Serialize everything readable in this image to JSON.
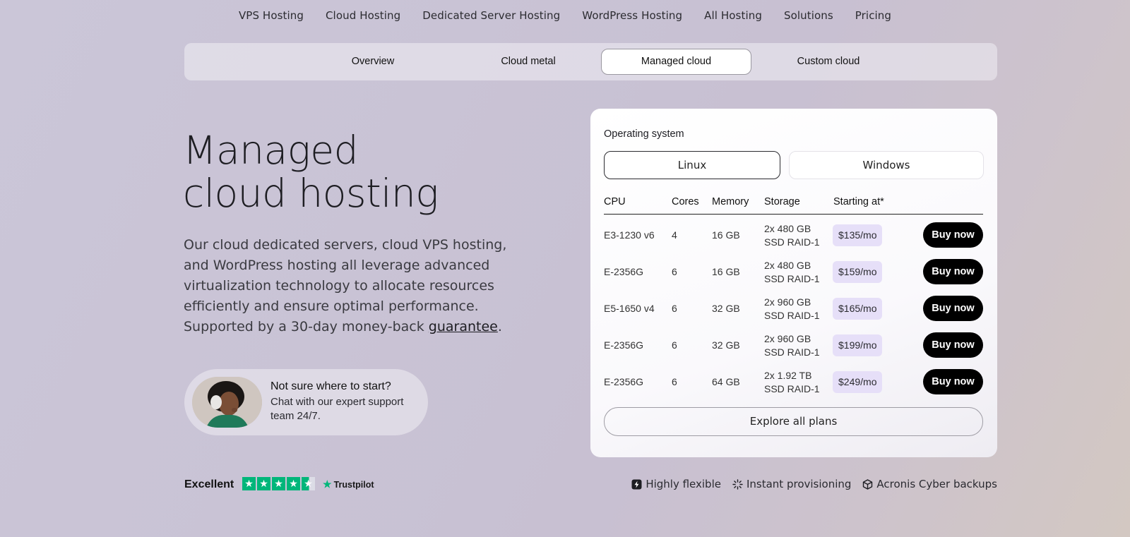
{
  "nav": [
    "VPS Hosting",
    "Cloud Hosting",
    "Dedicated Server Hosting",
    "WordPress Hosting",
    "All Hosting",
    "Solutions",
    "Pricing"
  ],
  "tabs": [
    "Overview",
    "Cloud metal",
    "Managed cloud",
    "Custom cloud"
  ],
  "active_tab": "Managed cloud",
  "hero": {
    "title_line1": "Managed",
    "title_line2": "cloud hosting",
    "desc_before": "Our cloud dedicated servers, cloud VPS hosting, and WordPress hosting all leverage advanced virtualization technology to allocate resources efficiently and ensure optimal performance. Supported by a 30-day money-back ",
    "desc_link": "guarantee",
    "desc_after": "."
  },
  "support": {
    "title": "Not sure where to start?",
    "text": "Chat with our expert support team 24/7."
  },
  "card": {
    "os_label": "Operating system",
    "os_options": [
      "Linux",
      "Windows"
    ],
    "os_selected": "Linux",
    "headers": [
      "CPU",
      "Cores",
      "Memory",
      "Storage",
      "Starting at*"
    ],
    "rows": [
      {
        "cpu": "E3-1230 v6",
        "cores": "4",
        "memory": "16 GB",
        "storage_1": "2x 480 GB",
        "storage_2": "SSD RAID-1",
        "price": "$135/mo"
      },
      {
        "cpu": "E-2356G",
        "cores": "6",
        "memory": "16 GB",
        "storage_1": "2x 480 GB",
        "storage_2": "SSD RAID-1",
        "price": "$159/mo"
      },
      {
        "cpu": "E5-1650 v4",
        "cores": "6",
        "memory": "32 GB",
        "storage_1": "2x 960 GB",
        "storage_2": "SSD RAID-1",
        "price": "$165/mo"
      },
      {
        "cpu": "E-2356G",
        "cores": "6",
        "memory": "32 GB",
        "storage_1": "2x 960 GB",
        "storage_2": "SSD RAID-1",
        "price": "$199/mo"
      },
      {
        "cpu": "E-2356G",
        "cores": "6",
        "memory": "64 GB",
        "storage_1": "2x 1.92 TB",
        "storage_2": "SSD RAID-1",
        "price": "$249/mo"
      }
    ],
    "buy_label": "Buy now",
    "explore_label": "Explore all plans"
  },
  "rating": {
    "word": "Excellent",
    "stars": 4.5,
    "brand": "Trustpilot"
  },
  "features": [
    {
      "icon": "lightning-icon",
      "label": "Highly flexible"
    },
    {
      "icon": "sparkle-icon",
      "label": "Instant provisioning"
    },
    {
      "icon": "cube-icon",
      "label": "Acronis Cyber backups"
    }
  ],
  "colors": {
    "price_badge": "#e6dff8",
    "buy_button": "#000000",
    "trustpilot_green": "#00b67a"
  }
}
